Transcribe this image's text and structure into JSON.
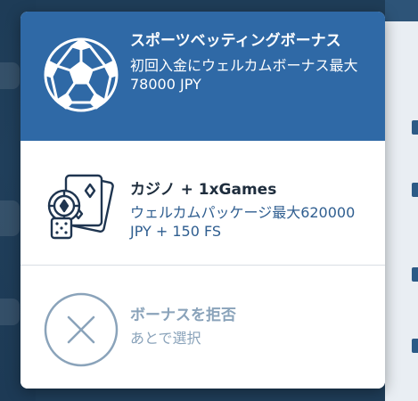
{
  "colors": {
    "sport_bg": "#2f69a6",
    "casino_title": "#1e2d3d",
    "casino_desc": "#2f5e90",
    "decline_text": "#8aa3ba"
  },
  "bonus_modal": {
    "options": [
      {
        "id": "sport",
        "icon": "soccer-ball-icon",
        "title": "スポーツベッティングボーナス",
        "description": "初回入金にウェルカムボーナス最大78000 JPY"
      },
      {
        "id": "casino",
        "icon": "casino-cards-chips-dice-icon",
        "title": "カジノ + 1xGames",
        "description": "ウェルカムパッケージ最大620000 JPY + 150 FS"
      },
      {
        "id": "decline",
        "icon": "close-circle-icon",
        "title": "ボーナスを拒否",
        "description": "あとで選択"
      }
    ]
  }
}
